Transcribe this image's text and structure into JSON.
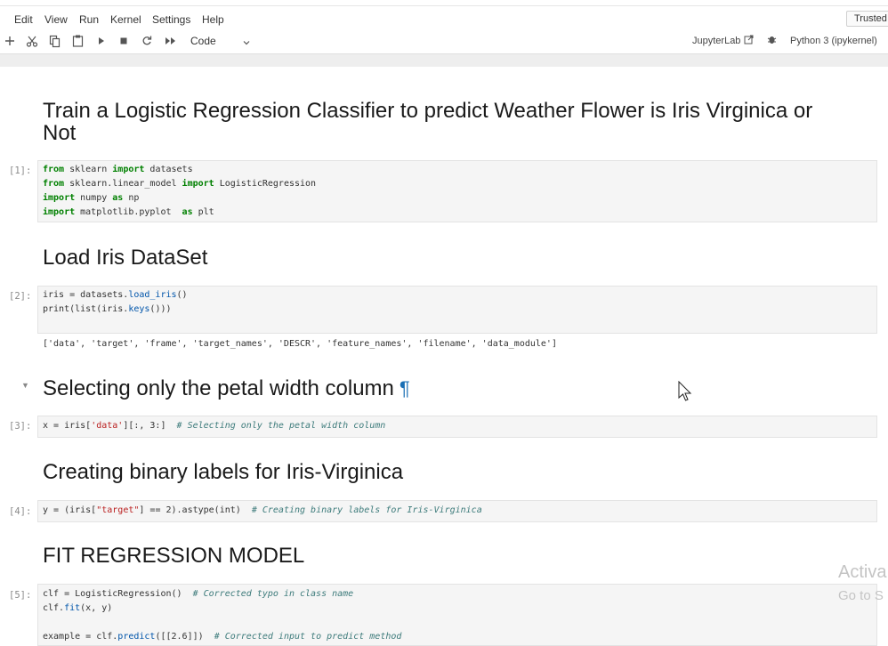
{
  "menu": [
    "Edit",
    "View",
    "Run",
    "Kernel",
    "Settings",
    "Help"
  ],
  "trusted": "Trusted",
  "toolbar": {
    "cell_type": "Code",
    "jupyterlab": "JupyterLab",
    "kernel": "Python 3 (ipykernel)"
  },
  "notebook": {
    "title_line1": "Train a Logistic Regression Classifier to predict Weather Flower is Iris Virginica or",
    "title_line2": "Not",
    "cells": {
      "c1": {
        "prompt": "[1]:",
        "lines": [
          {
            "kw1": "from",
            "t1": " sklearn ",
            "kw2": "import",
            "t2": " datasets"
          },
          {
            "kw1": "from",
            "t1": " sklearn.linear_model ",
            "kw2": "import",
            "t2": " LogisticRegression"
          },
          {
            "kw1": "import",
            "t1": " numpy ",
            "kw2": "as",
            "t2": " np"
          },
          {
            "kw1": "import",
            "t1": " matplotlib.pyplot  ",
            "kw2": "as",
            "t2": " plt"
          }
        ]
      },
      "h_load": "Load Iris DataSet",
      "c2": {
        "prompt": "[2]:",
        "l1a": "iris = datasets.",
        "l1b": "load_iris",
        "l1c": "()",
        "l2a": "print(list(iris.",
        "l2b": "keys",
        "l2c": "()))",
        "output": "['data', 'target', 'frame', 'target_names', 'DESCR', 'feature_names', 'filename', 'data_module']"
      },
      "h_select": "Selecting only the petal width column",
      "pilcrow": "¶",
      "c3": {
        "prompt": "[3]:",
        "a": "x = iris[",
        "s": "'data'",
        "b": "][:, 3:]  ",
        "comment": "# Selecting only the petal width column"
      },
      "h_binary": "Creating binary labels for Iris-Virginica",
      "c4": {
        "prompt": "[4]:",
        "a": "y = (iris[",
        "s": "\"target\"",
        "b": "] == 2).astype(int)  ",
        "comment": "# Creating binary labels for Iris-Virginica"
      },
      "h_fit": "FIT REGRESSION MODEL",
      "c5": {
        "prompt": "[5]:",
        "l1a": "clf = LogisticRegression()  ",
        "l1c": "# Corrected typo in class name",
        "l2a": "clf.",
        "l2b": "fit",
        "l2c": "(x, y)",
        "l3a": "example = clf.",
        "l3b": "predict",
        "l3c": "([[2.6]])  ",
        "l3d": "# Corrected input to predict method"
      }
    }
  },
  "watermark": {
    "line1": "Activa",
    "line2": "Go to S"
  }
}
